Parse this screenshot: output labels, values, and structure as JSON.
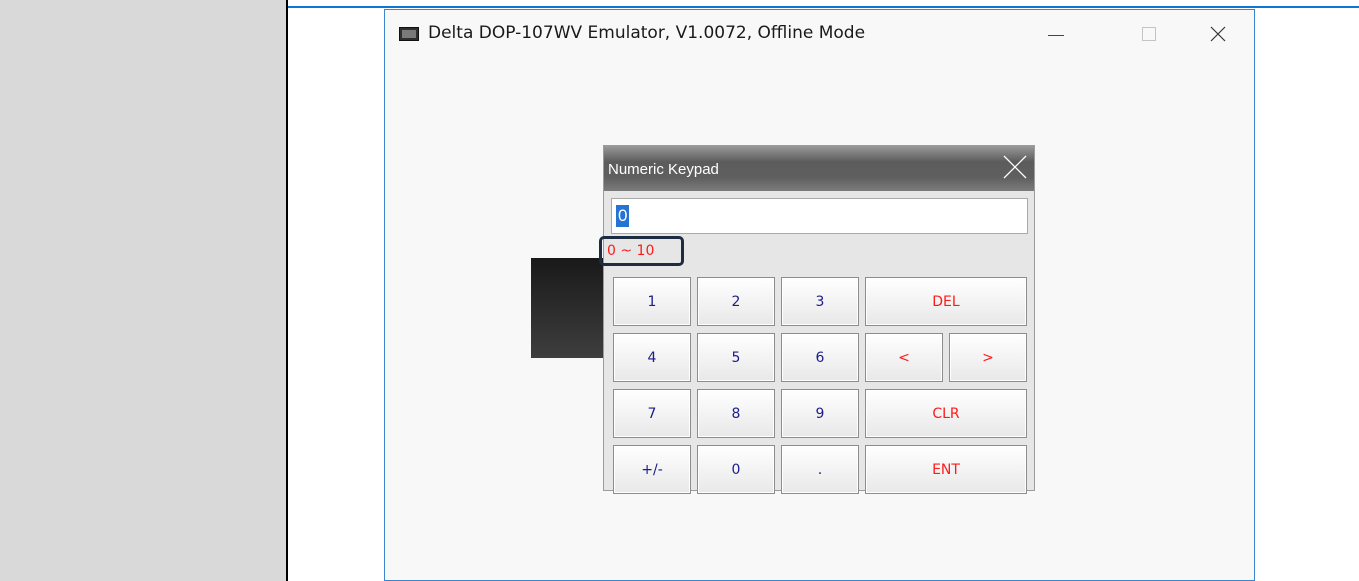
{
  "window": {
    "title": "Delta DOP-107WV Emulator, V1.0072, Offline Mode",
    "icon": "monitor-icon",
    "controls": [
      "minimize-icon",
      "maximize-icon",
      "close-icon"
    ]
  },
  "keypad": {
    "title": "Numeric Keypad",
    "input_value": "0",
    "range": "0 ~ 10",
    "keys": {
      "k1": "1",
      "k2": "2",
      "k3": "3",
      "del": "DEL",
      "k4": "4",
      "k5": "5",
      "k6": "6",
      "left": "<",
      "right": ">",
      "k7": "7",
      "k8": "8",
      "k9": "9",
      "clr": "CLR",
      "sign": "+/-",
      "k0": "0",
      "dot": ".",
      "ent": "ENT"
    }
  },
  "colors": {
    "accent_blue": "#0d76d6",
    "selection": "#2574d4",
    "function_key_text": "#ff1a1a",
    "digit_key_text": "#1c1c8a",
    "range_text": "#ff1a1a",
    "highlight_box": "#1e2c42"
  }
}
